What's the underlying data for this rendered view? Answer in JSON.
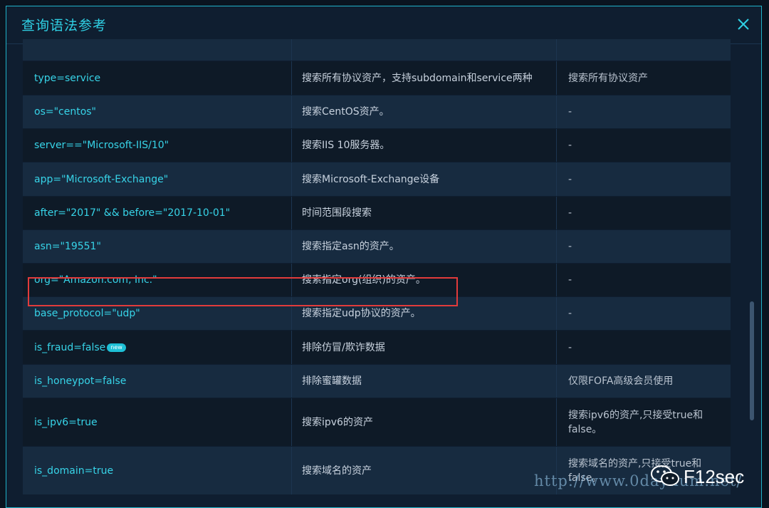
{
  "dialog": {
    "title": "查询语法参考"
  },
  "table": {
    "rows": [
      {
        "syntax": "",
        "desc": "",
        "note": ""
      },
      {
        "syntax": "type=service",
        "desc": "搜索所有协议资产，支持subdomain和service两种",
        "note": "搜索所有协议资产"
      },
      {
        "syntax": "os=\"centos\"",
        "desc": "搜索CentOS资产。",
        "note": "-"
      },
      {
        "syntax": "server==\"Microsoft-IIS/10\"",
        "desc": "搜索IIS 10服务器。",
        "note": "-"
      },
      {
        "syntax": "app=\"Microsoft-Exchange\"",
        "desc": "搜索Microsoft-Exchange设备",
        "note": "-"
      },
      {
        "syntax": "after=\"2017\" && before=\"2017-10-01\"",
        "desc": "时间范围段搜索",
        "note": "-"
      },
      {
        "syntax": "asn=\"19551\"",
        "desc": "搜索指定asn的资产。",
        "note": "-"
      },
      {
        "syntax": "org=\"Amazon.com, Inc.\"",
        "desc": "搜索指定org(组织)的资产。",
        "note": "-"
      },
      {
        "syntax": "base_protocol=\"udp\"",
        "desc": "搜索指定udp协议的资产。",
        "note": "-"
      },
      {
        "syntax": "is_fraud=false",
        "desc": "排除仿冒/欺诈数据",
        "note": "-",
        "badge": "new"
      },
      {
        "syntax": "is_honeypot=false",
        "desc": "排除蜜罐数据",
        "note": "仅限FOFA高级会员使用"
      },
      {
        "syntax": "is_ipv6=true",
        "desc": "搜索ipv6的资产",
        "note": "搜索ipv6的资产,只接受true和false。"
      },
      {
        "syntax": "is_domain=true",
        "desc": "搜索域名的资产",
        "note": "搜索域名的资产,只接受true和false。"
      }
    ]
  },
  "watermark": {
    "url": "http://www.0daynum.net/",
    "brand": "F12sec"
  }
}
